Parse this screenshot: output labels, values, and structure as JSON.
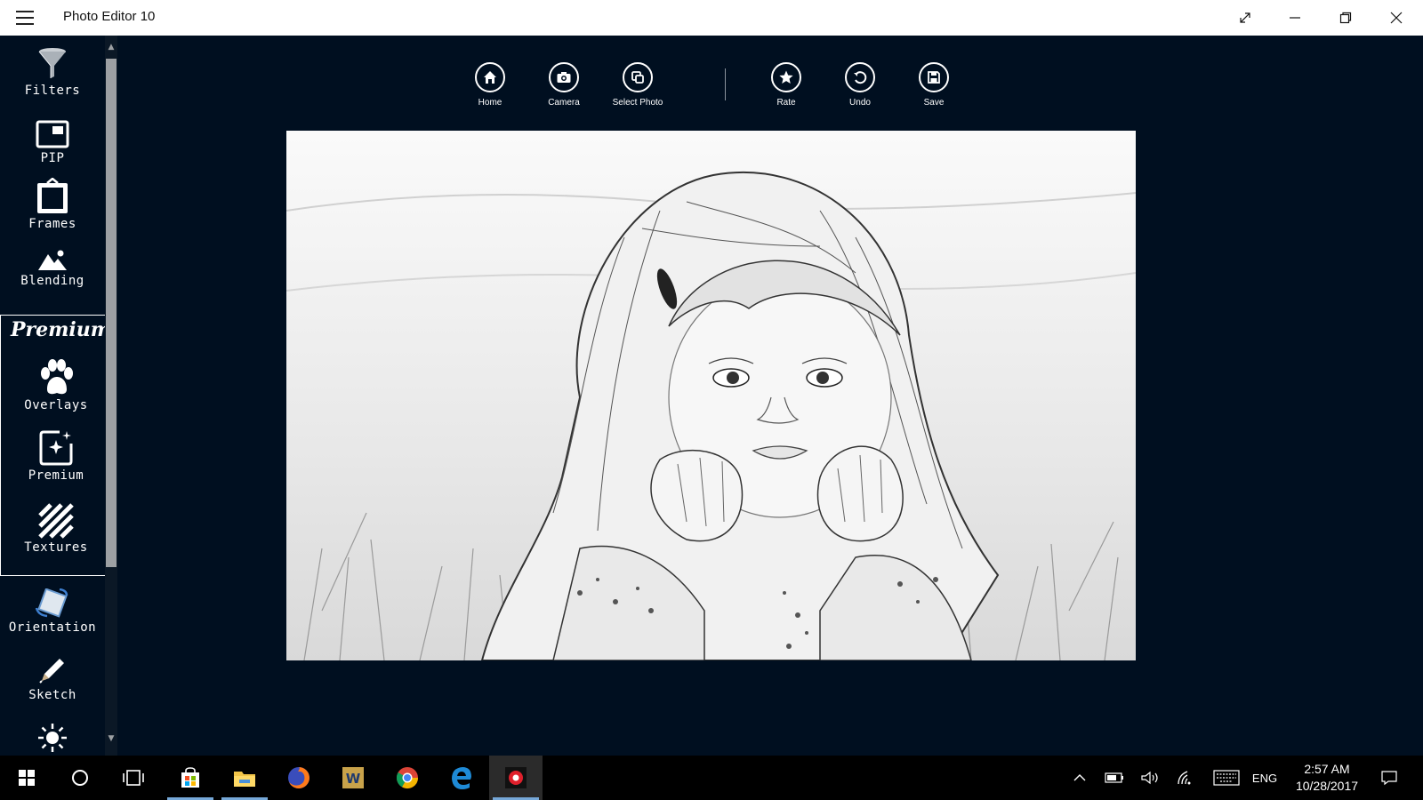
{
  "window": {
    "title": "Photo Editor 10"
  },
  "sidebar": {
    "tools": [
      {
        "label": "Filters",
        "icon": "funnel-icon"
      },
      {
        "label": "PIP",
        "icon": "picture-in-picture-icon"
      },
      {
        "label": "Frames",
        "icon": "frame-icon"
      },
      {
        "label": "Blending",
        "icon": "mountain-icon"
      },
      {
        "label": "Overlays",
        "icon": "paw-icon"
      },
      {
        "label": "Premium",
        "icon": "sparkle-image-icon"
      },
      {
        "label": "Textures",
        "icon": "stripes-icon"
      },
      {
        "label": "Orientation",
        "icon": "rotate-image-icon"
      },
      {
        "label": "Sketch",
        "icon": "pencil-icon"
      },
      {
        "label": "",
        "icon": "brightness-icon"
      }
    ],
    "premium_heading": "Premium"
  },
  "toolbar": {
    "buttons": [
      {
        "label": "Home",
        "icon": "home-icon"
      },
      {
        "label": "Camera",
        "icon": "camera-icon"
      },
      {
        "label": "Select Photo",
        "icon": "select-photo-icon"
      },
      {
        "label": "Rate",
        "icon": "star-icon"
      },
      {
        "label": "Undo",
        "icon": "undo-icon"
      },
      {
        "label": "Save",
        "icon": "save-icon"
      }
    ]
  },
  "photo": {
    "description_icon": "sketch-photo-icon"
  },
  "taskbar": {
    "language": "ENG",
    "time": "2:57 AM",
    "date": "10/28/2017"
  },
  "colors": {
    "app_background": "#000f20",
    "titlebar": "#ffffff",
    "taskbar": "#000000",
    "taskbar_indicator": "#76a8d8"
  }
}
